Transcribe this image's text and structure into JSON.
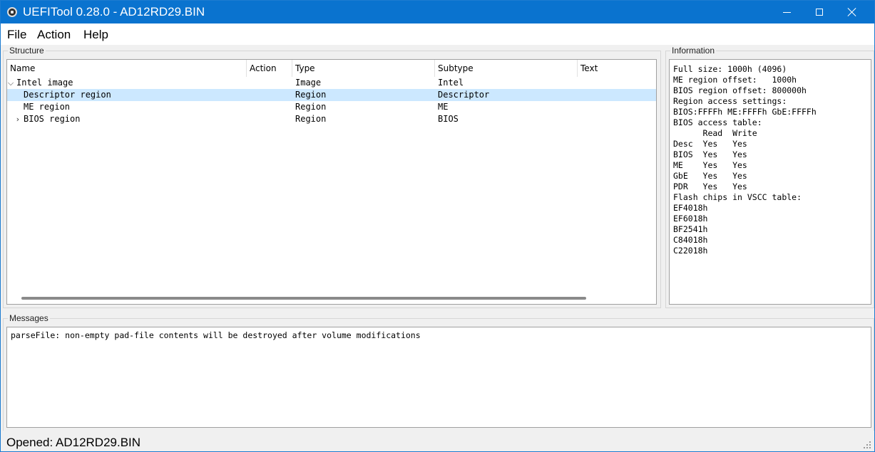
{
  "window": {
    "title": "UEFITool 0.28.0 - AD12RD29.BIN",
    "icon": "uefitool-app-icon",
    "controls": [
      "minimize",
      "maximize",
      "close"
    ]
  },
  "menu": {
    "items": [
      "File",
      "Action",
      "Help"
    ]
  },
  "structure": {
    "label": "Structure",
    "columns": [
      "Name",
      "Action",
      "Type",
      "Subtype",
      "Text"
    ],
    "rows": [
      {
        "name": "Intel image",
        "action": "",
        "type": "Image",
        "subtype": "Intel",
        "text": "",
        "expander": "expanded"
      },
      {
        "name": "Descriptor region",
        "action": "",
        "type": "Region",
        "subtype": "Descriptor",
        "text": "",
        "expander": "none",
        "selected": true
      },
      {
        "name": "ME region",
        "action": "",
        "type": "Region",
        "subtype": "ME",
        "text": "",
        "expander": "none"
      },
      {
        "name": "BIOS region",
        "action": "",
        "type": "Region",
        "subtype": "BIOS",
        "text": "",
        "expander": "collapsed"
      }
    ]
  },
  "information": {
    "label": "Information",
    "lines": [
      "Full size: 1000h (4096)",
      "ME region offset:   1000h",
      "BIOS region offset: 800000h",
      "Region access settings:",
      "BIOS:FFFFh ME:FFFFh GbE:FFFFh",
      "BIOS access table:",
      "      Read  Write",
      "Desc  Yes   Yes",
      "BIOS  Yes   Yes",
      "ME    Yes   Yes",
      "GbE   Yes   Yes",
      "PDR   Yes   Yes",
      "Flash chips in VSCC table:",
      "EF4018h",
      "EF6018h",
      "BF2541h",
      "C84018h",
      "C22018h"
    ]
  },
  "messages": {
    "label": "Messages",
    "lines": [
      "parseFile: non-empty pad-file contents will be destroyed after volume modifications"
    ]
  },
  "status": {
    "text": "Opened: AD12RD29.BIN"
  },
  "colors": {
    "titlebar": "#0a73cf",
    "selection": "#cce8ff"
  }
}
